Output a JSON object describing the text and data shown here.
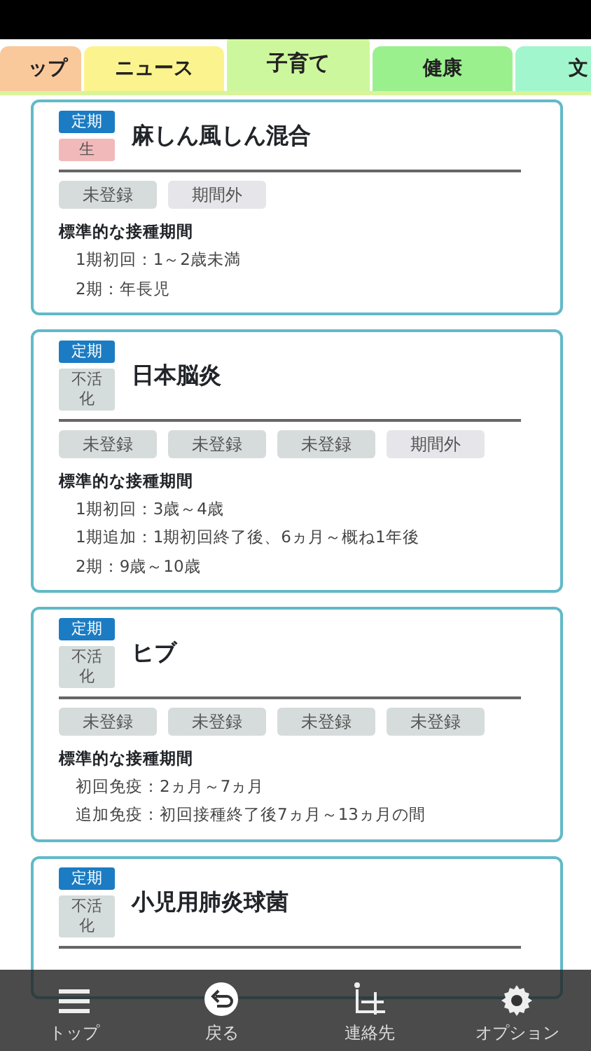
{
  "tabs": [
    {
      "label": "ップ",
      "selected": false,
      "color": "#f9c99c"
    },
    {
      "label": "ニュース",
      "selected": false,
      "color": "#fbf48e"
    },
    {
      "label": "子育て",
      "selected": true,
      "color": "#cdf79d"
    },
    {
      "label": "健康",
      "selected": false,
      "color": "#9bf08e"
    },
    {
      "label": "文",
      "selected": false,
      "color": "#a2f6cd"
    }
  ],
  "cards": [
    {
      "badges": [
        {
          "label": "定期",
          "kind": "routine"
        },
        {
          "label": "生",
          "kind": "live"
        }
      ],
      "title": "麻しん風しん混合",
      "chips": [
        {
          "label": "未登録",
          "kind": "unregistered"
        },
        {
          "label": "期間外",
          "kind": "out_of_period"
        }
      ],
      "period_heading": "標準的な接種期間",
      "periods": [
        "1期初回：1～2歳未満",
        "2期：年長児"
      ]
    },
    {
      "badges": [
        {
          "label": "定期",
          "kind": "routine"
        },
        {
          "label": "不活化",
          "kind": "inactivated"
        }
      ],
      "title": "日本脳炎",
      "chips": [
        {
          "label": "未登録",
          "kind": "unregistered"
        },
        {
          "label": "未登録",
          "kind": "unregistered"
        },
        {
          "label": "未登録",
          "kind": "unregistered"
        },
        {
          "label": "期間外",
          "kind": "out_of_period"
        }
      ],
      "period_heading": "標準的な接種期間",
      "periods": [
        "1期初回：3歳～4歳",
        "1期追加：1期初回終了後、6ヵ月～概ね1年後",
        "2期：9歳～10歳"
      ]
    },
    {
      "badges": [
        {
          "label": "定期",
          "kind": "routine"
        },
        {
          "label": "不活化",
          "kind": "inactivated"
        }
      ],
      "title": "ヒブ",
      "chips": [
        {
          "label": "未登録",
          "kind": "unregistered"
        },
        {
          "label": "未登録",
          "kind": "unregistered"
        },
        {
          "label": "未登録",
          "kind": "unregistered"
        },
        {
          "label": "未登録",
          "kind": "unregistered"
        }
      ],
      "period_heading": "標準的な接種期間",
      "periods": [
        "初回免疫：2ヵ月～7ヵ月",
        "追加免疫：初回接種終了後7ヵ月～13ヵ月の間"
      ]
    },
    {
      "badges": [
        {
          "label": "定期",
          "kind": "routine"
        },
        {
          "label": "不活化",
          "kind": "inactivated"
        }
      ],
      "title": "小児用肺炎球菌"
    }
  ],
  "bottom_nav": [
    {
      "label": "トップ",
      "kind": "menu"
    },
    {
      "label": "戻る",
      "kind": "back"
    },
    {
      "label": "連絡先",
      "kind": "contact"
    },
    {
      "label": "オプション",
      "kind": "settings"
    }
  ]
}
